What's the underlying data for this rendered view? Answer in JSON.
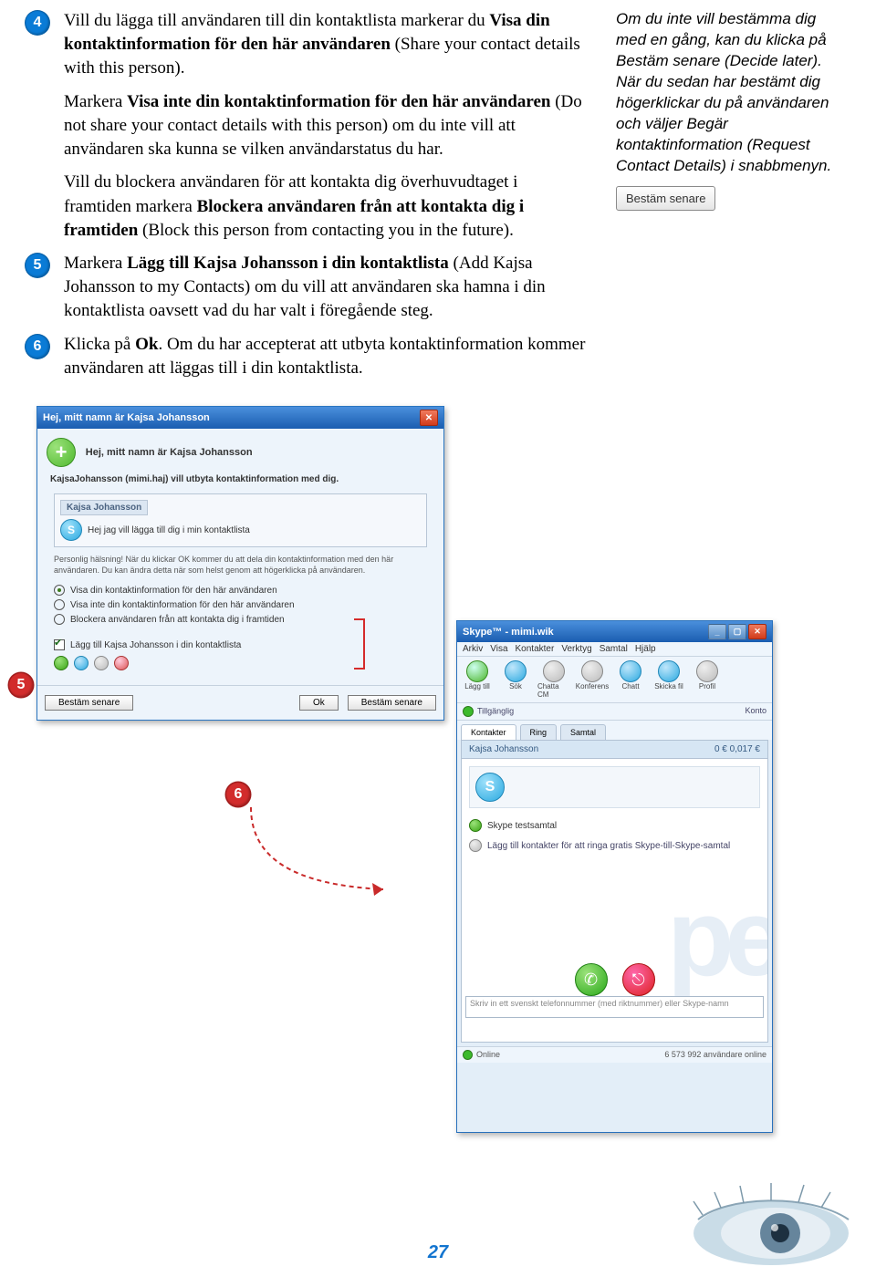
{
  "steps": {
    "s4": {
      "num": "4",
      "p1_a": "Vill du lägga till användaren till din kontaktlista markerar du ",
      "p1_b": "Visa din kontaktinformation för den här användaren",
      "p1_c": " (Share your contact details with this person).",
      "p2_a": "Markera ",
      "p2_b": "Visa inte din kontaktinformation för den här användaren",
      "p2_c": " (Do not share your contact details with this person) om du inte vill att användaren ska kunna se vilken användarstatus du har.",
      "p3_a": "Vill du blockera användaren för att kontakta dig överhuvudtaget i framtiden markera ",
      "p3_b": "Blockera användaren från att kontakta dig i framtiden",
      "p3_c": " (Block this person from contacting you in the future)."
    },
    "s5": {
      "num": "5",
      "p1_a": "Markera ",
      "p1_b": "Lägg till Kajsa Johansson i din kontaktlista",
      "p1_c": " (Add Kajsa Johansson to my Contacts) om du vill att användaren ska hamna i din kontaktlista oavsett vad du har valt i föregående steg."
    },
    "s6": {
      "num": "6",
      "p1_a": "Klicka på ",
      "p1_b": "Ok",
      "p1_c": ". Om du har accepterat att utbyta kontaktinformation kommer användaren att läggas till i din kontaktlista."
    }
  },
  "sidebar": {
    "text": "Om du inte vill bestämma dig med en gång, kan du klicka på Bestäm senare (Decide later). När du sedan har bestämt dig högerklickar du på användaren och väljer Begär kontaktinformation (Request Contact Details) i snabbmenyn.",
    "button": "Bestäm senare"
  },
  "dialog": {
    "title": "Hej, mitt namn är Kajsa Johansson",
    "header": "Hej, mitt namn är Kajsa Johansson",
    "sub": "KajsaJohansson (mimi.haj) vill utbyta kontaktinformation med dig.",
    "card_title": "Kajsa Johansson",
    "card_text": "Hej jag vill lägga till dig i min kontaktlista",
    "note": "Personlig hälsning! När du klickar OK kommer du att dela din kontaktinformation med den här användaren. Du kan ändra detta när som helst genom att högerklicka på användaren.",
    "opt1": "Visa din kontaktinformation för den här användaren",
    "opt2": "Visa inte din kontaktinformation för den här användaren",
    "opt3": "Blockera användaren från att kontakta dig i framtiden",
    "opt4": "Lägg till Kajsa Johansson i din kontaktlista",
    "btn_later": "Bestäm senare",
    "btn_ok": "Ok",
    "btn_decide": "Bestäm senare"
  },
  "callouts": {
    "c4": "4",
    "c5": "5",
    "c6": "6"
  },
  "skype": {
    "title": "Skype™ - mimi.wik",
    "menu1": "Arkiv",
    "menu2": "Visa",
    "menu3": "Kontakter",
    "menu4": "Verktyg",
    "menu5": "Samtal",
    "menu6": "Hjälp",
    "tb1": "Lägg till",
    "tb2": "Sök",
    "tb3": "Chatta CM",
    "tb4": "Konferens",
    "tb5": "Chatt",
    "tb6": "Skicka fil",
    "tb7": "Profil",
    "status_left": "Tillgänglig",
    "status_right": "Konto",
    "tab1": "Kontakter",
    "tab2": "Ring",
    "tab3": "Samtal",
    "contact_hdr": "Kajsa Johansson",
    "contact_rate": "0 €  0,017 €",
    "cline1": "Skype testsamtal",
    "cline2": "Lägg till kontakter för att ringa gratis Skype-till-Skype-samtal",
    "input_placeholder": "Skriv in ett svenskt telefonnummer (med riktnummer) eller Skype-namn",
    "statusbar_left": "Online",
    "statusbar_right": "6 573 992 användare online"
  },
  "page_number": "27"
}
